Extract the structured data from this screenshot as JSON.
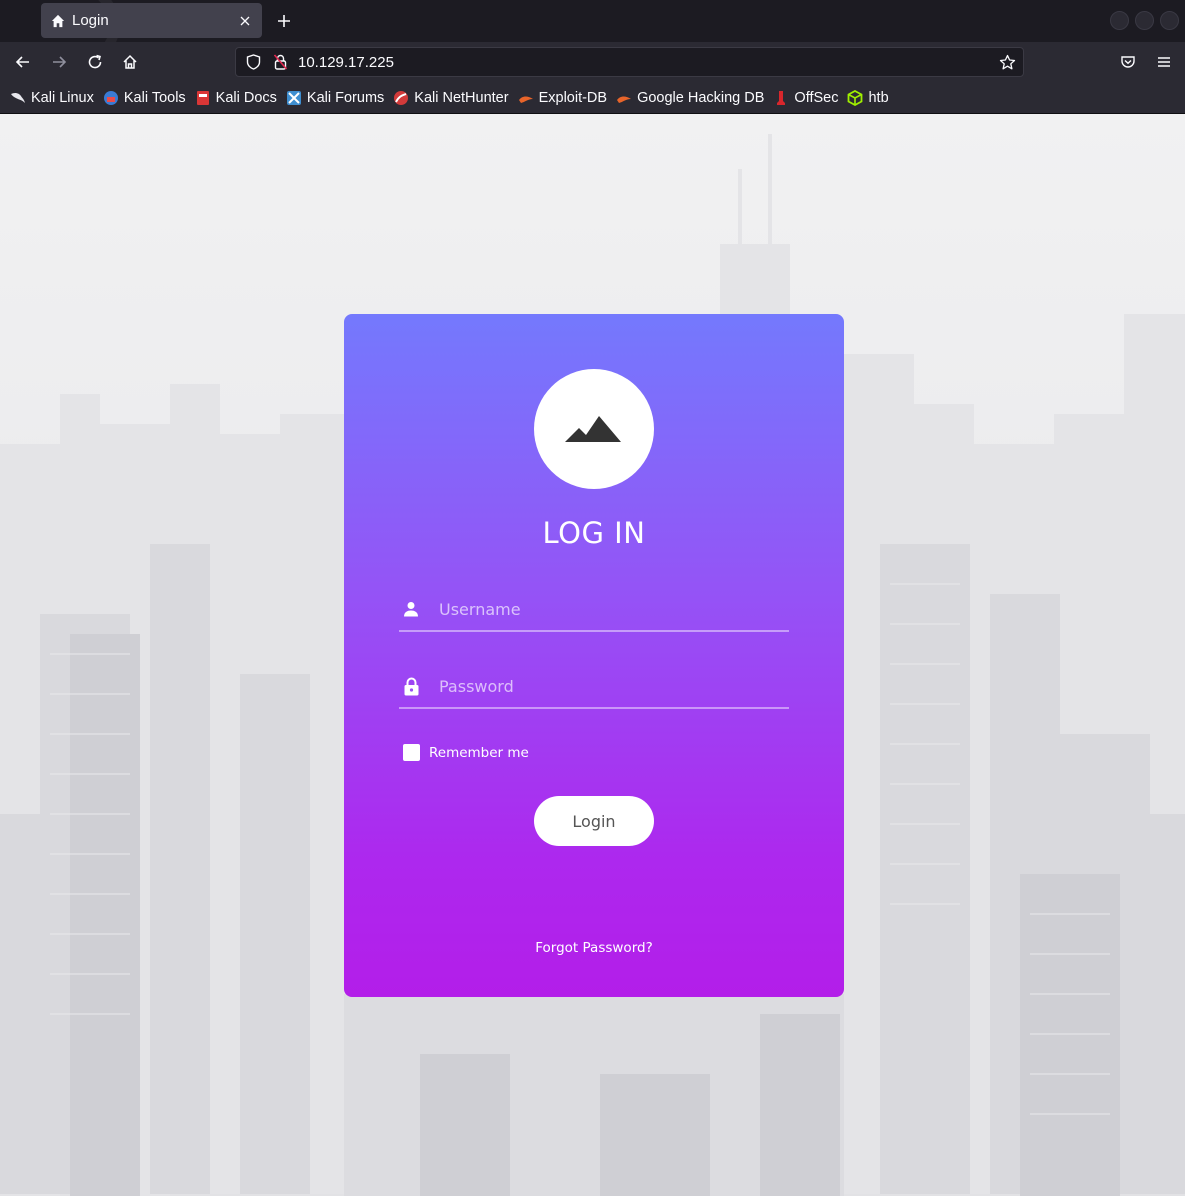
{
  "browser": {
    "tab": {
      "title": "Login",
      "favicon": "home-icon"
    },
    "url": "10.129.17.225",
    "bookmarks": [
      {
        "label": "Kali Linux",
        "icon": "kali-dragon-icon"
      },
      {
        "label": "Kali Tools",
        "icon": "kali-tools-icon"
      },
      {
        "label": "Kali Docs",
        "icon": "kali-docs-icon"
      },
      {
        "label": "Kali Forums",
        "icon": "kali-forums-icon"
      },
      {
        "label": "Kali NetHunter",
        "icon": "kali-nethunter-icon"
      },
      {
        "label": "Exploit-DB",
        "icon": "exploit-db-icon"
      },
      {
        "label": "Google Hacking DB",
        "icon": "ghdb-icon"
      },
      {
        "label": "OffSec",
        "icon": "offsec-icon"
      },
      {
        "label": "htb",
        "icon": "htb-icon"
      }
    ]
  },
  "login": {
    "title": "LOG IN",
    "username_placeholder": "Username",
    "password_placeholder": "Password",
    "remember_label": "Remember me",
    "login_label": "Login",
    "forgot_label": "Forgot Password?"
  },
  "colors": {
    "card_top": "#7479fd",
    "card_bottom": "#b31ee9",
    "chrome_dark": "#1c1b22",
    "chrome": "#2b2a33"
  }
}
